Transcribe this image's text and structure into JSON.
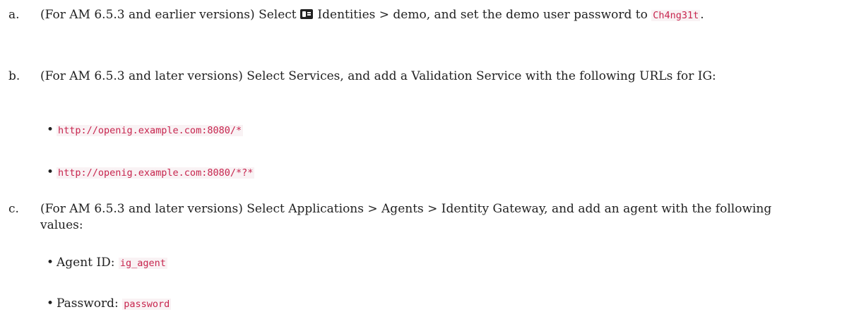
{
  "steps": [
    {
      "marker": "a.",
      "text_before": "(For AM 6.5.3 and earlier versions) Select ",
      "icon": "identities-card-icon",
      "text_after": " Identities > demo, and set the demo user password to ",
      "code": "Ch4ng31t",
      "text_end": "."
    },
    {
      "marker": "b.",
      "text": "(For AM 6.5.3 and later versions) Select Services, and add a Validation Service with the following URLs for IG:",
      "urls": [
        "http://openig.example.com:8080/*",
        "http://openig.example.com:8080/*?*"
      ]
    },
    {
      "marker": "c.",
      "text": "(For AM 6.5.3 and later versions) Select Applications > Agents > Identity Gateway, and add an agent with the following values:",
      "values": [
        {
          "label": "Agent ID: ",
          "code": "ig_agent"
        },
        {
          "label": "Password: ",
          "code": "password"
        }
      ]
    }
  ],
  "bullet_glyph": "•"
}
